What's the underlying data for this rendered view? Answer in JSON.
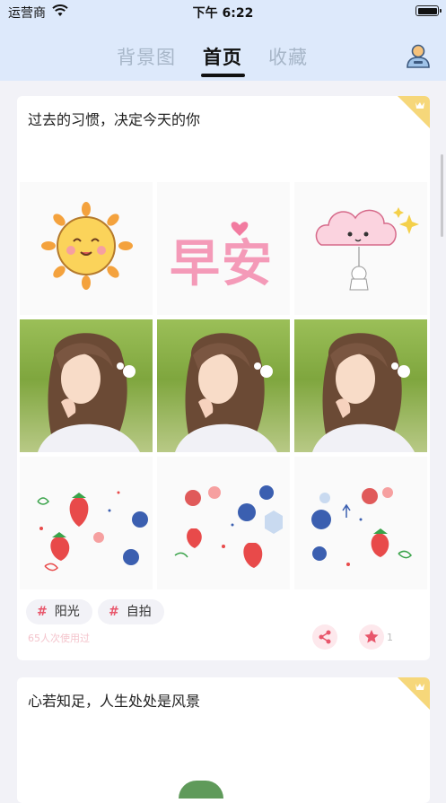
{
  "status_bar": {
    "carrier": "运营商",
    "time": "下午 6:22"
  },
  "nav": {
    "tabs": [
      {
        "label": "背景图",
        "active": false
      },
      {
        "label": "首页",
        "active": true
      },
      {
        "label": "收藏",
        "active": false
      }
    ]
  },
  "cards": [
    {
      "title": "过去的习惯，决定今天的你",
      "tags": [
        "阳光",
        "自拍"
      ],
      "usage": "65人次使用过",
      "favorite_count": "1",
      "grid_text": "早安"
    },
    {
      "title": "心若知足，人生处处是风景"
    }
  ],
  "colors": {
    "accent": "#e8566b",
    "nav_bg": "#dde9fb",
    "page_bg": "#f2f2f7",
    "badge": "#f6d77a"
  }
}
